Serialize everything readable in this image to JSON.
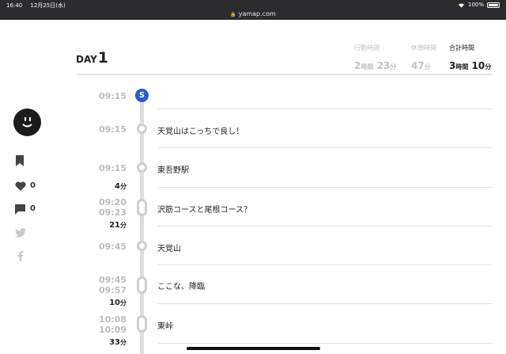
{
  "status_bar": {
    "time": "16:40",
    "date": "12月25日(水)",
    "battery": "100%",
    "url": "yamap.com"
  },
  "sidebar": {
    "bookmark_icon": "bookmark-icon",
    "like_count": "0",
    "comment_count": "0"
  },
  "header": {
    "day_label": "DAY",
    "day_number": "1",
    "stats": [
      {
        "caption": "行動時間",
        "hours": "2",
        "hours_unit": "時間",
        "minutes": "23",
        "minutes_unit": "分"
      },
      {
        "caption": "休憩時間",
        "minutes": "47",
        "minutes_unit": "分"
      },
      {
        "caption": "合計時間",
        "hours": "3",
        "hours_unit": "時間",
        "minutes": "10",
        "minutes_unit": "分"
      }
    ]
  },
  "timeline": {
    "start": {
      "time": "09:15",
      "marker": "S"
    },
    "entries": [
      {
        "time": "09:15",
        "name": "天覚山はこっちで良し！"
      },
      {
        "time": "09:15",
        "name": "東吾野駅"
      },
      {
        "duration": "4",
        "duration_unit": "分"
      },
      {
        "time_start": "09:20",
        "time_end": "09:23",
        "name": "沢筋コースと尾根コース？"
      },
      {
        "duration": "21",
        "duration_unit": "分"
      },
      {
        "time": "09:45",
        "name": "天覚山"
      },
      {
        "time_start": "09:45",
        "time_end": "09:57",
        "name": "ここな、降臨"
      },
      {
        "duration": "10",
        "duration_unit": "分"
      },
      {
        "time_start": "10:08",
        "time_end": "10:09",
        "name": "東峠"
      },
      {
        "duration": "33",
        "duration_unit": "分"
      }
    ]
  },
  "colors": {
    "accent": "#2a5cc4",
    "timeline": "#dedede",
    "muted": "#bdbdbd"
  }
}
